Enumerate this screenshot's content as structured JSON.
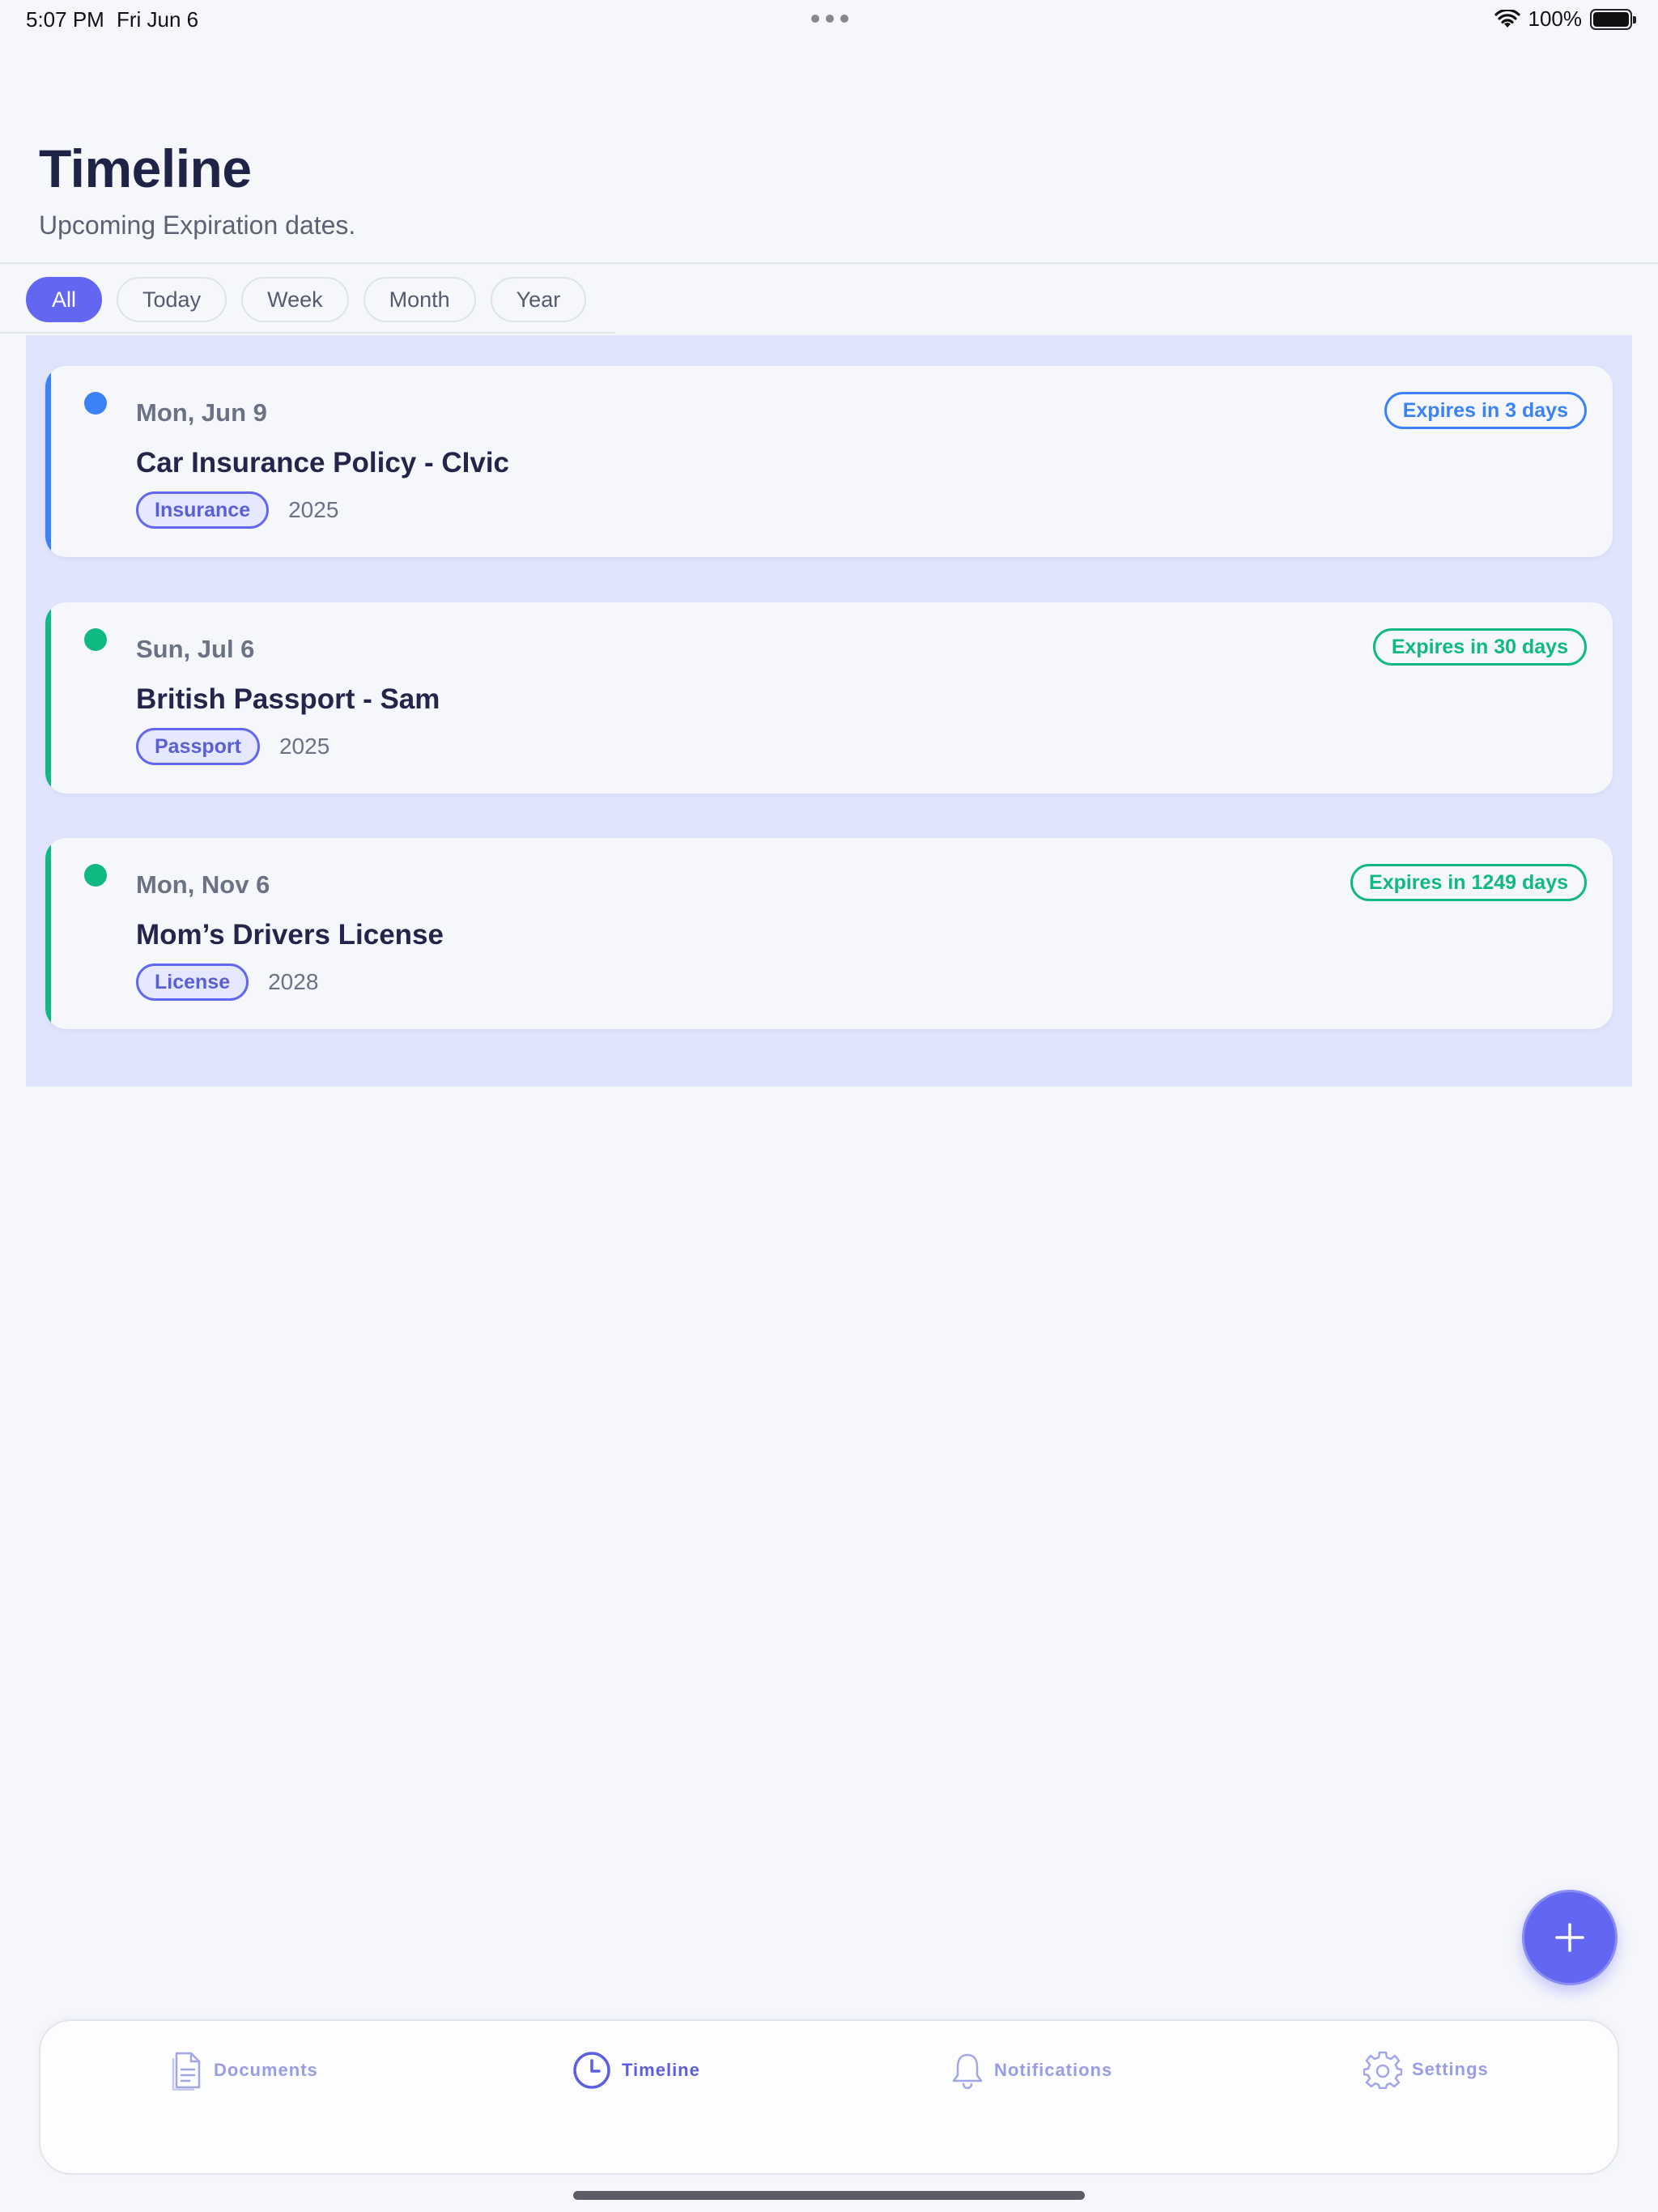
{
  "status_bar": {
    "time": "5:07 PM",
    "date": "Fri Jun 6",
    "battery": "100%",
    "icons": [
      "wifi-icon",
      "battery-icon"
    ]
  },
  "header": {
    "title": "Timeline",
    "subtitle": "Upcoming Expiration dates."
  },
  "filters": [
    {
      "label": "All",
      "active": true
    },
    {
      "label": "Today",
      "active": false
    },
    {
      "label": "Week",
      "active": false
    },
    {
      "label": "Month",
      "active": false
    },
    {
      "label": "Year",
      "active": false
    }
  ],
  "items": [
    {
      "date": "Mon, Jun 9",
      "title": "Car Insurance Policy - CIvic",
      "tag": "Insurance",
      "year": "2025",
      "badge": "Expires in 3 days",
      "color": "#3b82f6"
    },
    {
      "date": "Sun, Jul 6",
      "title": "British Passport - Sam",
      "tag": "Passport",
      "year": "2025",
      "badge": "Expires in 30 days",
      "color": "#10b981"
    },
    {
      "date": "Mon, Nov 6",
      "title": "Mom’s Drivers License",
      "tag": "License",
      "year": "2028",
      "badge": "Expires in 1249 days",
      "color": "#10b981"
    }
  ],
  "fab": {
    "icon": "plus-icon"
  },
  "tabbar": [
    {
      "label": "Documents",
      "icon": "document-icon",
      "active": false
    },
    {
      "label": "Timeline",
      "icon": "clock-icon",
      "active": true
    },
    {
      "label": "Notifications",
      "icon": "bell-icon",
      "active": false
    },
    {
      "label": "Settings",
      "icon": "gear-icon",
      "active": false
    }
  ],
  "colors": {
    "accent": "#6366f1",
    "blue": "#3b82f6",
    "green": "#10b981",
    "panel": "#e0e5fd"
  }
}
